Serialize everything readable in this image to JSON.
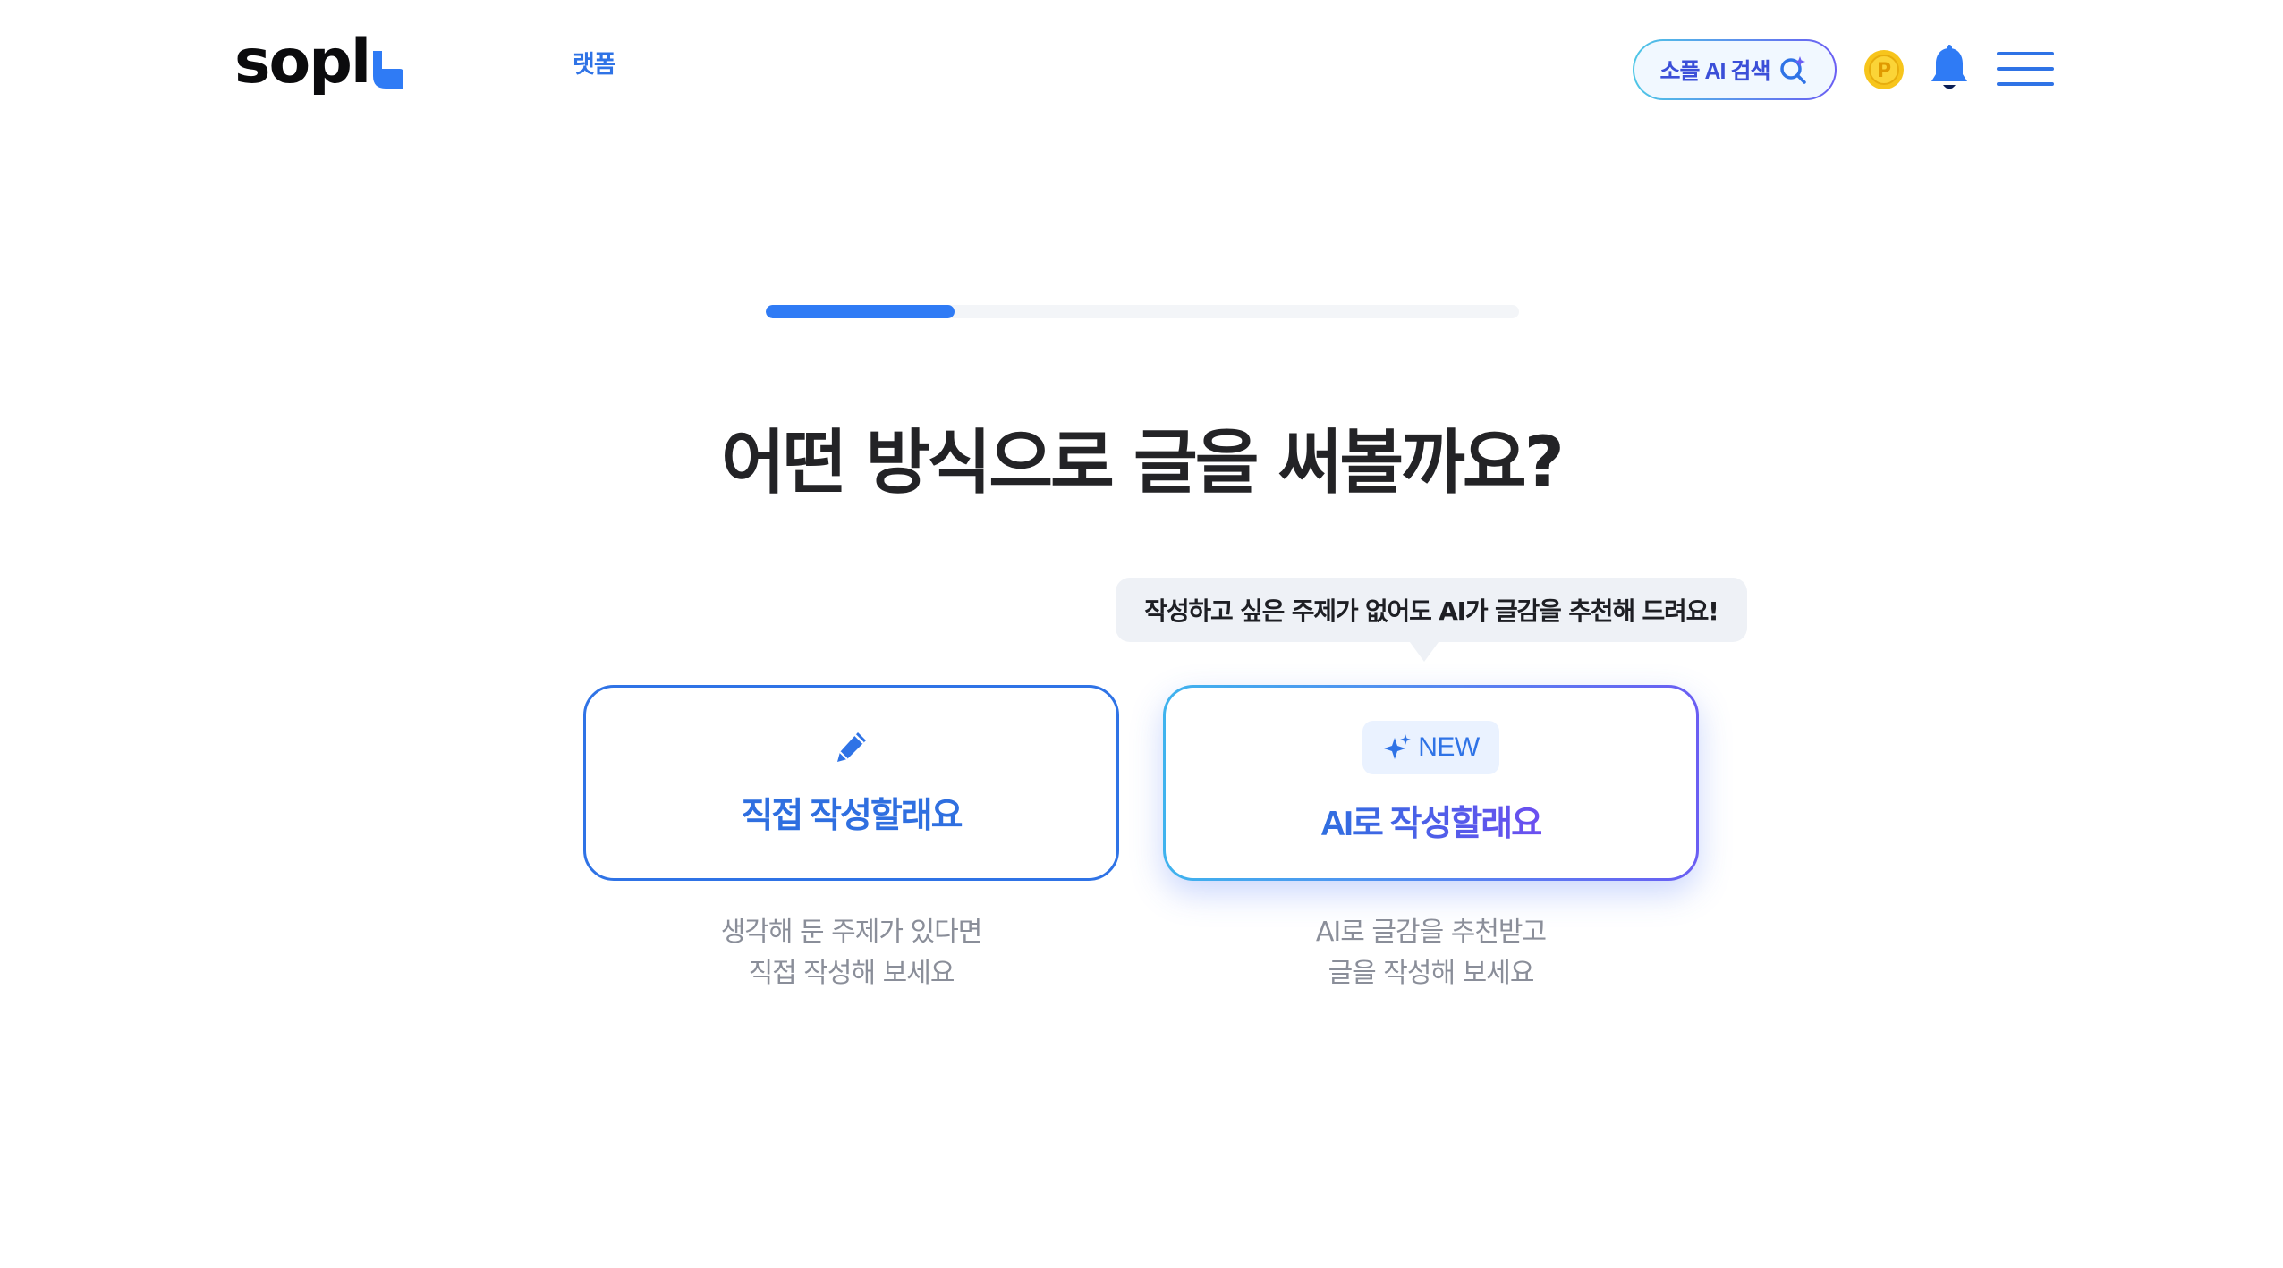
{
  "header": {
    "logo_text": "sopl",
    "nav_link": "랫폼",
    "ai_search_label": "소플 AI 검색",
    "icons": {
      "ai_search": "search-sparkle-icon",
      "point": "point-coin-icon",
      "notification": "bell-icon",
      "menu": "hamburger-menu-icon"
    },
    "point_label": "P"
  },
  "progress": {
    "value": 0.25
  },
  "title": "어떤 방식으로 글을 써볼까요?",
  "tooltip": "작성하고 싶은 주제가 없어도 AI가 글감을 추천해 드려요!",
  "options": [
    {
      "icon": "pencil-icon",
      "label": "직접 작성할래요",
      "description": [
        "생각해 둔 주제가 있다면",
        "직접 작성해 보세요"
      ]
    },
    {
      "badge": "NEW",
      "badge_icon": "sparkle-icon",
      "label": "AI로 작성할래요",
      "description": [
        "AI로 글감을 추천받고",
        "글을 작성해 보세요"
      ]
    }
  ],
  "colors": {
    "primary": "#2f73e6",
    "progress_fill": "#2f7bf5",
    "progress_track": "#f3f5f8",
    "ai_gradient_start": "#3fb3ee",
    "ai_gradient_end": "#6a5ef3",
    "coin": "#f7c51c",
    "tooltip_bg": "#eef1f6",
    "description_text": "#8a8e99"
  }
}
